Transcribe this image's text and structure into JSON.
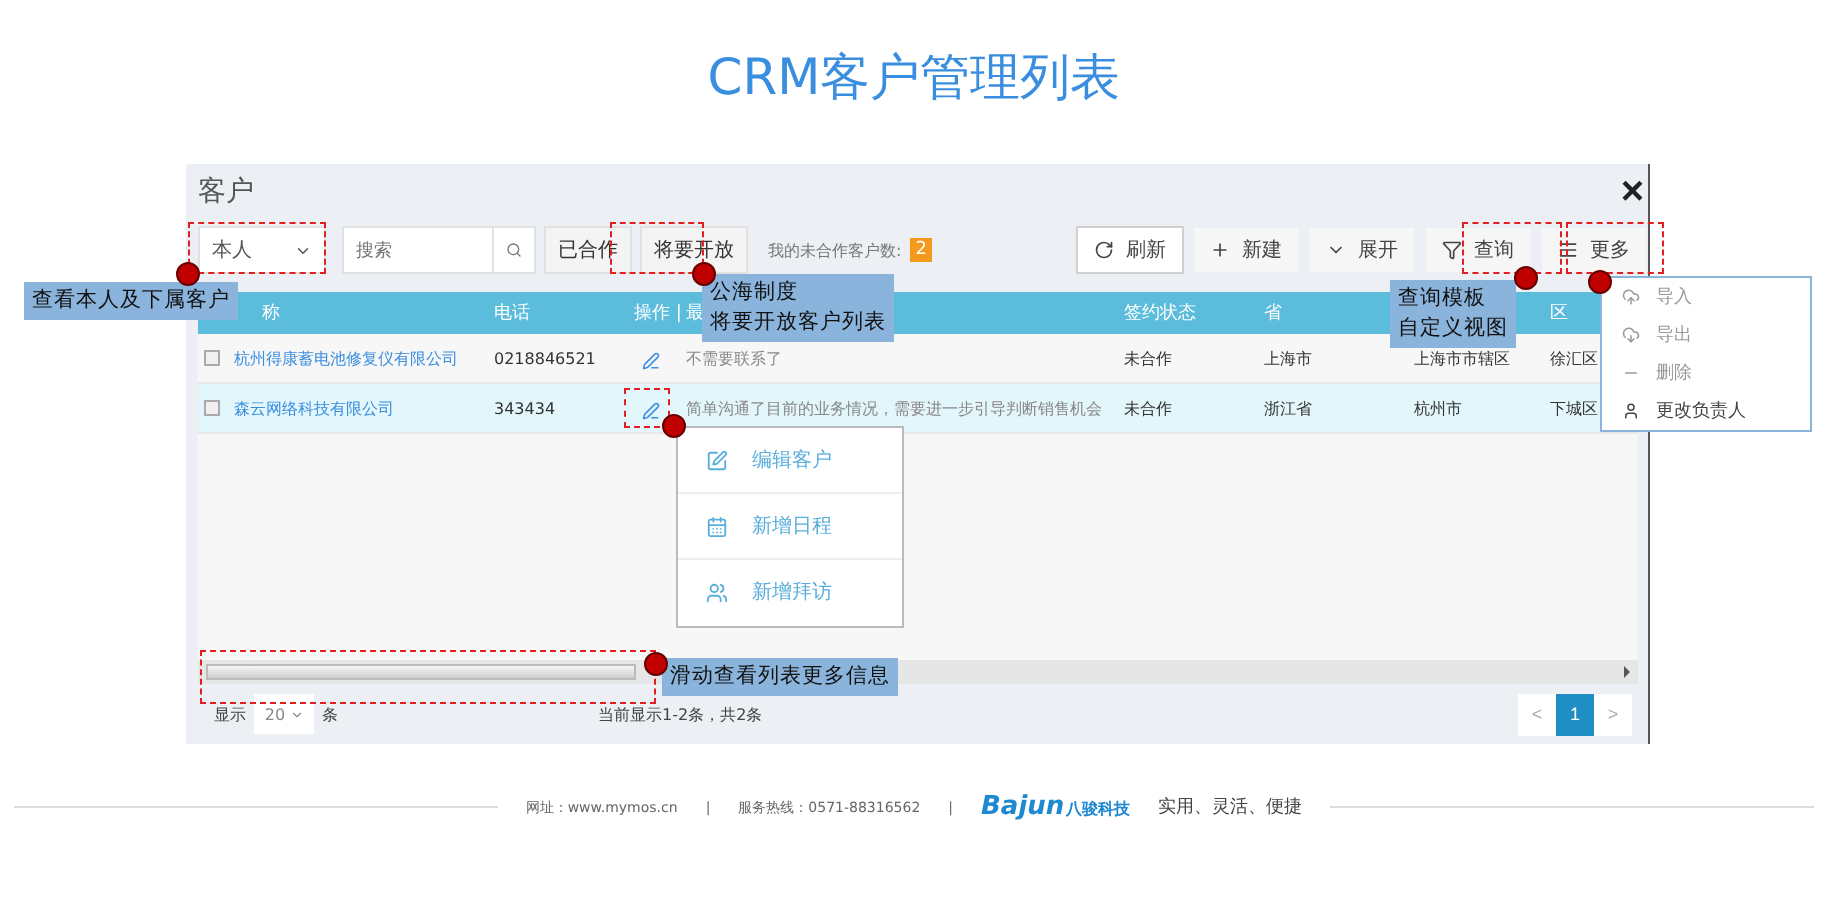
{
  "page_title": "CRM客户管理列表",
  "dialog": {
    "title": "客户",
    "close": "×"
  },
  "toolbar": {
    "owner_select": "本人",
    "search": {
      "placeholder": "搜索"
    },
    "filters": [
      "已合作",
      "将要开放"
    ],
    "count_label": "我的未合作客户数:",
    "count": "2",
    "actions": [
      {
        "kind": "refresh",
        "label": "刷新"
      },
      {
        "kind": "new",
        "label": "新建"
      },
      {
        "kind": "expand",
        "label": "展开"
      },
      {
        "kind": "query",
        "label": "查询"
      },
      {
        "kind": "more",
        "label": "更多"
      }
    ]
  },
  "table": {
    "columns": [
      {
        "label": "称"
      },
      {
        "label": "电话"
      },
      {
        "label": "操作 |"
      },
      {
        "label": "最"
      },
      {
        "label": "签约状态"
      },
      {
        "label": "省"
      },
      {},
      {
        "label": "区"
      }
    ],
    "rows": [
      {
        "checked": false,
        "selected": false,
        "cells": [
          "杭州得康蓄电池修复仪有限公司",
          "0218846521",
          "",
          "不需要联系了",
          "未合作",
          "上海市",
          "上海市市辖区",
          "徐汇区"
        ]
      },
      {
        "checked": false,
        "selected": true,
        "cells": [
          "森云网络科技有限公司",
          "343434",
          "",
          "简单沟通了目前的业务情况，需要进一步引导判断销售机会",
          "未合作",
          "浙江省",
          "杭州市",
          "下城区"
        ]
      }
    ]
  },
  "row_menu": [
    {
      "kind": "edit",
      "label": "编辑客户"
    },
    {
      "kind": "calendar",
      "label": "新增日程"
    },
    {
      "kind": "visit",
      "label": "新增拜访"
    }
  ],
  "more_menu": [
    {
      "kind": "import",
      "label": "导入",
      "disabled": true
    },
    {
      "kind": "export",
      "label": "导出",
      "disabled": true
    },
    {
      "kind": "delete",
      "label": "删除",
      "disabled": true
    },
    {
      "kind": "owner",
      "label": "更改负责人",
      "disabled": false
    }
  ],
  "footer": {
    "show_label": "显示",
    "page_size": "20",
    "unit": "条",
    "summary": "当前显示1-2条，共2条",
    "prev": "<",
    "next": ">",
    "pages": [
      {
        "label": "1",
        "selected": true
      }
    ]
  },
  "callouts": [
    {
      "lines": [
        "查看本人及下属客户"
      ]
    },
    {
      "lines": [
        "公海制度",
        "将要开放客户列表"
      ]
    },
    {
      "lines": [
        "查询模板",
        "自定义视图"
      ]
    },
    {
      "lines": [
        "滑动查看列表更多信息"
      ]
    }
  ],
  "site_footer": {
    "website": "网址：www.mymos.cn",
    "separator": "|",
    "hotline": "服务热线：0571-88316562",
    "logo_latin": "Bajun",
    "logo_cn": "八骏科技",
    "slogan": "实用、灵活、便捷"
  }
}
